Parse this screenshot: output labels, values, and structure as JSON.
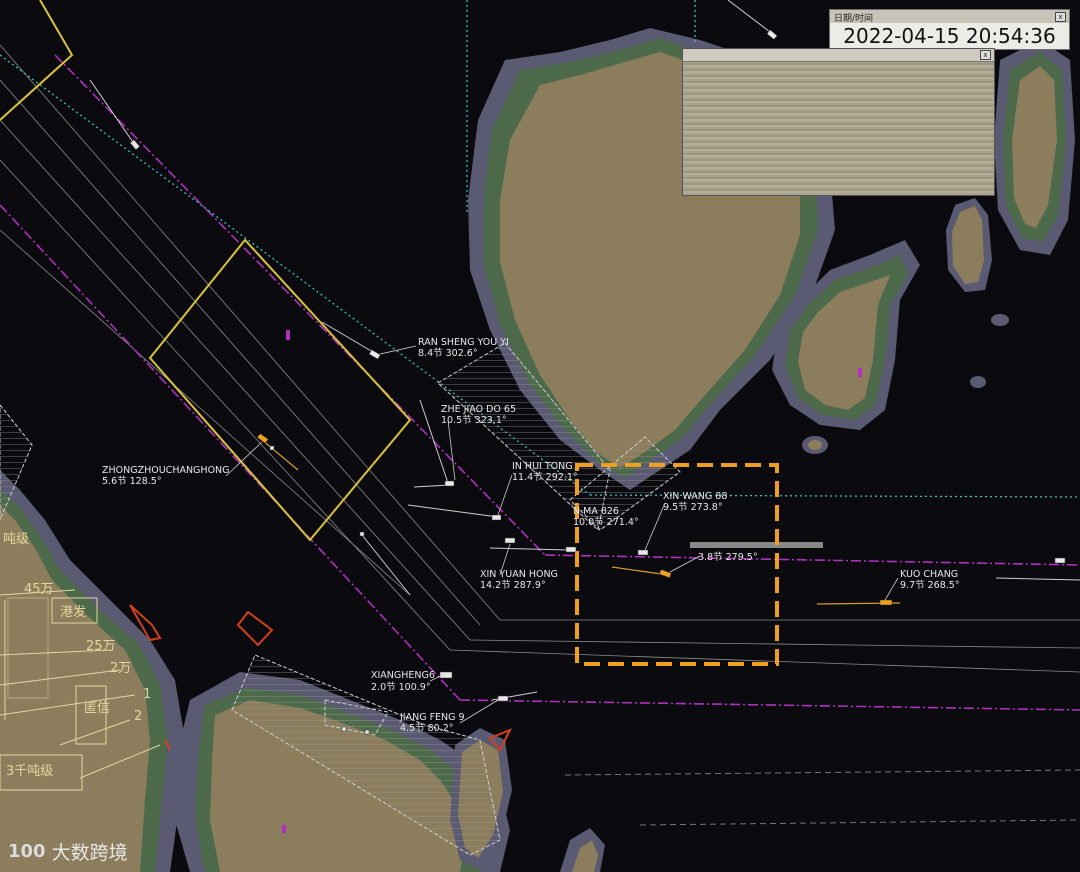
{
  "datetime_panel": {
    "title": "日期/时间",
    "value": "2022-04-15 20:54:36",
    "close": "x"
  },
  "info_panel": {
    "close": "x"
  },
  "vessels": [
    {
      "id": "ran",
      "name": "RAN SHENG YOU YI",
      "info": "8.4节 302.6°"
    },
    {
      "id": "zhe",
      "name": "ZHE JIAO DO 65",
      "info": "10.5节 323.1°"
    },
    {
      "id": "zzch",
      "name": "ZHONGZHOUCHANGHONG",
      "info": "5.6节 128.5°"
    },
    {
      "id": "inhui",
      "name": "IN HUI TONG",
      "info": "11.4节 292.1°"
    },
    {
      "id": "xinwang",
      "name": "XIN WANG 88",
      "info": "9.5节 273.8°"
    },
    {
      "id": "nma",
      "name": "N MA 826",
      "info": "10.0节 271.4°"
    },
    {
      "id": "unk",
      "name": "",
      "info": "3.8节 279.5°"
    },
    {
      "id": "xyh",
      "name": "XIN YUAN HONG",
      "info": "14.2节 287.9°"
    },
    {
      "id": "kuo",
      "name": "KUO CHANG",
      "info": "9.7节 268.5°"
    },
    {
      "id": "xh",
      "name": "XIANGHENG6",
      "info": "2.0节 100.9°"
    },
    {
      "id": "jf",
      "name": "JIANG FENG 9",
      "info": "4.5节 80.2°"
    }
  ],
  "chart_labels": {
    "l45": "45万",
    "ganghu": "港发",
    "l25": "25万",
    "l2w": "2万",
    "n1": "1",
    "n2": "2",
    "jinxin": "匿信",
    "l3q": "3千吨级",
    "dunji": "吨级"
  },
  "watermark": {
    "logo": "100",
    "text": "大数跨境"
  },
  "colors": {
    "land": "#8c7d5c",
    "land_green": "#4e6b4c",
    "shallow": "#5f5f78",
    "water": "#0b0b0f",
    "yellow": "#d8c33c",
    "magenta": "#b030c0",
    "cyan": "#3ac0c0",
    "highlight": "#f0a020"
  }
}
